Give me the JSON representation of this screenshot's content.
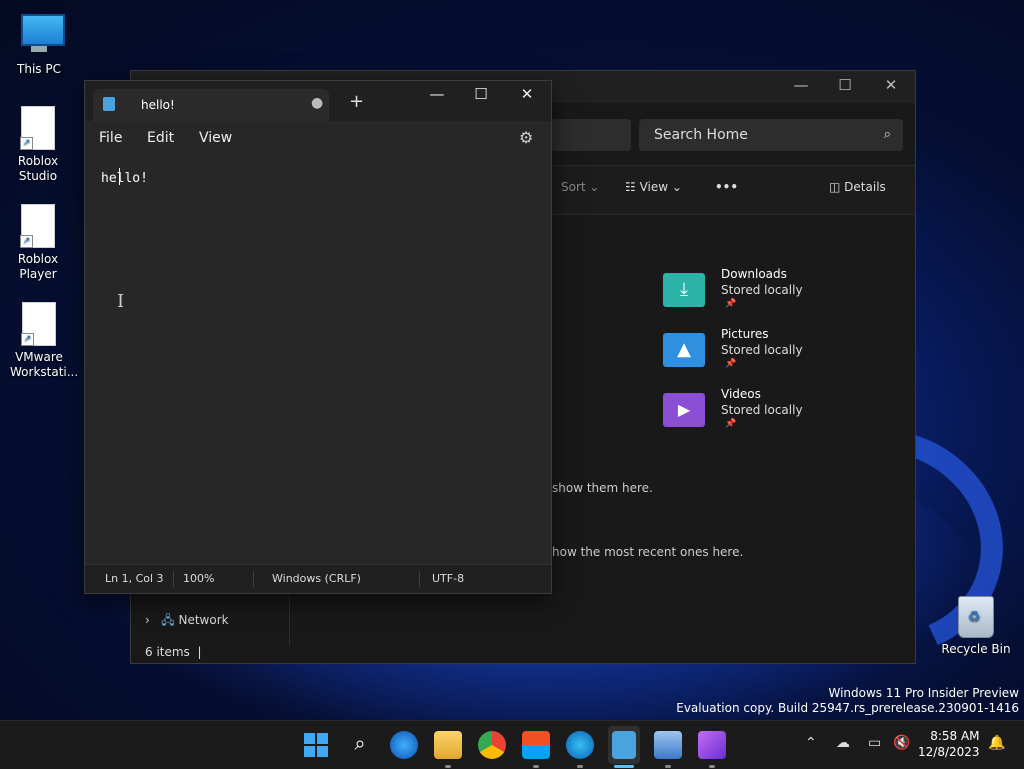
{
  "desktop": {
    "icons": [
      {
        "label": "This PC"
      },
      {
        "label": "Roblox Studio"
      },
      {
        "label": "Roblox Player"
      },
      {
        "label": "VMware Workstati..."
      }
    ],
    "recycle_bin": "Recycle Bin",
    "watermark_line1": "Windows 11 Pro Insider Preview",
    "watermark_line2": "Evaluation copy. Build 25947.rs_prerelease.230901-1416"
  },
  "explorer": {
    "search_placeholder": "Search Home",
    "cmd_sort": "Sort",
    "cmd_view": "View",
    "cmd_more": "•••",
    "cmd_details": "Details",
    "quick_access": [
      {
        "name": "Downloads",
        "status": "Stored locally",
        "color": "#2bb3a8"
      },
      {
        "name": "Pictures",
        "status": "Stored locally",
        "color": "#2f8fe0"
      },
      {
        "name": "Videos",
        "status": "Stored locally",
        "color": "#8b4fd6"
      }
    ],
    "favorites_hint": "show them here.",
    "recent_hint": "how the most recent ones here.",
    "nav_network": "Network",
    "status_items": "6 items"
  },
  "notepad": {
    "tab_title": "hello!",
    "menu": [
      "File",
      "Edit",
      "View"
    ],
    "content": "hello!",
    "status": {
      "position": "Ln 1, Col 3",
      "zoom": "100%",
      "line_ending": "Windows (CRLF)",
      "encoding": "UTF-8"
    }
  },
  "taskbar": {
    "clock_time": "8:58 AM",
    "clock_date": "12/8/2023"
  }
}
